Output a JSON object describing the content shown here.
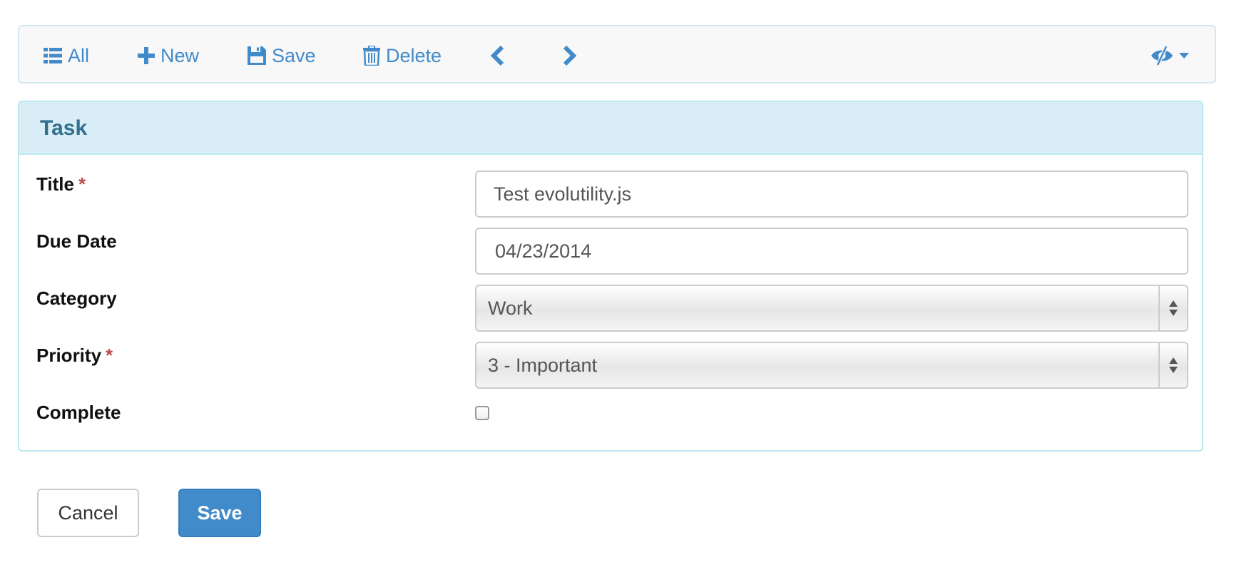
{
  "toolbar": {
    "all_label": "All",
    "new_label": "New",
    "save_label": "Save",
    "delete_label": "Delete",
    "icons": {
      "all": "list-icon",
      "new": "plus-icon",
      "save": "floppy-disk-icon",
      "delete": "trash-icon",
      "prev": "chevron-left-icon",
      "next": "chevron-right-icon",
      "view": "eye-slash-icon",
      "view_menu": "caret-down-icon"
    },
    "accent_color": "#428bca"
  },
  "panel": {
    "title": "Task",
    "fields": {
      "title": {
        "label": "Title",
        "required_mark": "*",
        "value": "Test evolutility.js"
      },
      "due_date": {
        "label": "Due Date",
        "value": "04/23/2014"
      },
      "category": {
        "label": "Category",
        "selected": "Work"
      },
      "priority": {
        "label": "Priority",
        "required_mark": "*",
        "selected": "3 - Important"
      },
      "complete": {
        "label": "Complete",
        "checked": false
      }
    },
    "heading_color": "#d9edf7",
    "title_color": "#31708f"
  },
  "actions": {
    "cancel_label": "Cancel",
    "save_label": "Save",
    "save_color": "#428bca"
  }
}
